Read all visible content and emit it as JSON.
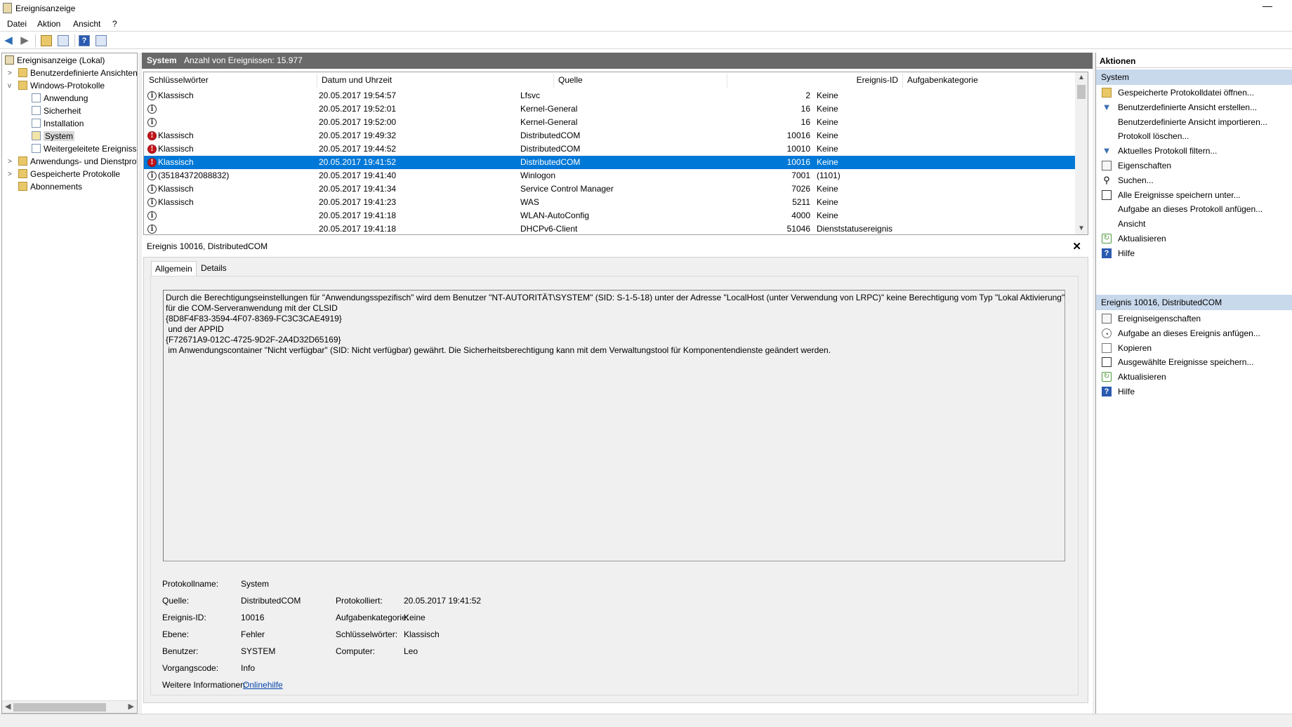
{
  "window": {
    "title": "Ereignisanzeige",
    "minimize": "—"
  },
  "menu": [
    "Datei",
    "Aktion",
    "Ansicht",
    "?"
  ],
  "tree": {
    "items": [
      {
        "label": "Ereignisanzeige (Lokal)",
        "icon": "event-viewer-icon"
      },
      {
        "label": "Benutzerdefinierte Ansichten",
        "icon": "folder-icon",
        "expander": ">"
      },
      {
        "label": "Windows-Protokolle",
        "icon": "folder-icon",
        "expander": "v"
      },
      {
        "label": "Anwendung",
        "icon": "log-icon"
      },
      {
        "label": "Sicherheit",
        "icon": "log-icon"
      },
      {
        "label": "Installation",
        "icon": "log-icon"
      },
      {
        "label": "System",
        "icon": "log-icon",
        "selected": true
      },
      {
        "label": "Weitergeleitete Ereignisse",
        "icon": "log-icon"
      },
      {
        "label": "Anwendungs- und Dienstprotokolle",
        "icon": "folder-icon",
        "expander": ">"
      },
      {
        "label": "Gespeicherte Protokolle",
        "icon": "folder-icon",
        "expander": ">"
      },
      {
        "label": "Abonnements",
        "icon": "subscriptions-icon"
      }
    ]
  },
  "center": {
    "title": "System",
    "count": "Anzahl von Ereignissen: 15.977",
    "columns": [
      "Schlüsselwörter",
      "Datum und Uhrzeit",
      "Quelle",
      "Ereignis-ID",
      "Aufgabenkategorie"
    ],
    "rows": [
      {
        "level": "info",
        "keyword": "Klassisch",
        "date": "20.05.2017 19:54:57",
        "source": "Lfsvc",
        "id": "2",
        "task": "Keine"
      },
      {
        "level": "info",
        "keyword": "",
        "date": "20.05.2017 19:52:01",
        "source": "Kernel-General",
        "id": "16",
        "task": "Keine"
      },
      {
        "level": "info",
        "keyword": "",
        "date": "20.05.2017 19:52:00",
        "source": "Kernel-General",
        "id": "16",
        "task": "Keine"
      },
      {
        "level": "error",
        "keyword": "Klassisch",
        "date": "20.05.2017 19:49:32",
        "source": "DistributedCOM",
        "id": "10016",
        "task": "Keine"
      },
      {
        "level": "error",
        "keyword": "Klassisch",
        "date": "20.05.2017 19:44:52",
        "source": "DistributedCOM",
        "id": "10010",
        "task": "Keine"
      },
      {
        "level": "error",
        "keyword": "Klassisch",
        "date": "20.05.2017 19:41:52",
        "source": "DistributedCOM",
        "id": "10016",
        "task": "Keine",
        "selected": true
      },
      {
        "level": "info",
        "keyword": "(35184372088832)",
        "date": "20.05.2017 19:41:40",
        "source": "Winlogon",
        "id": "7001",
        "task": "(1101)"
      },
      {
        "level": "info",
        "keyword": "Klassisch",
        "date": "20.05.2017 19:41:34",
        "source": "Service Control Manager",
        "id": "7026",
        "task": "Keine"
      },
      {
        "level": "info",
        "keyword": "Klassisch",
        "date": "20.05.2017 19:41:23",
        "source": "WAS",
        "id": "5211",
        "task": "Keine"
      },
      {
        "level": "info",
        "keyword": "",
        "date": "20.05.2017 19:41:18",
        "source": "WLAN-AutoConfig",
        "id": "4000",
        "task": "Keine"
      },
      {
        "level": "info",
        "keyword": "",
        "date": "20.05.2017 19:41:18",
        "source": "DHCPv6-Client",
        "id": "51046",
        "task": "Dienststatusereignis"
      }
    ]
  },
  "detail": {
    "title": "Ereignis 10016, DistributedCOM",
    "close": "✕",
    "tabs": [
      "Allgemein",
      "Details"
    ],
    "description": "Durch die Berechtigungseinstellungen für \"Anwendungsspezifisch\" wird dem Benutzer \"NT-AUTORITÄT\\SYSTEM\" (SID: S-1-5-18) unter der Adresse \"LocalHost (unter Verwendung von LRPC)\" keine Berechtigung vom Typ \"Lokal Aktivierung\"\nfür die COM-Serveranwendung mit der CLSID\n{8D8F4F83-3594-4F07-8369-FC3C3CAE4919}\n und der APPID\n{F72671A9-012C-4725-9D2F-2A4D32D65169}\n im Anwendungscontainer \"Nicht verfügbar\" (SID: Nicht verfügbar) gewährt. Die Sicherheitsberechtigung kann mit dem Verwaltungstool für Komponentendienste geändert werden.",
    "fields": {
      "protokollname_label": "Protokollname:",
      "protokollname": "System",
      "quelle_label": "Quelle:",
      "quelle": "DistributedCOM",
      "protokolliert_label": "Protokolliert:",
      "protokolliert": "20.05.2017 19:41:52",
      "ereignis_id_label": "Ereignis-ID:",
      "ereignis_id": "10016",
      "aufgabenkategorie_label": "Aufgabenkategorie:",
      "aufgabenkategorie": "Keine",
      "ebene_label": "Ebene:",
      "ebene": "Fehler",
      "schluesselwoerter_label": "Schlüsselwörter:",
      "schluesselwoerter": "Klassisch",
      "benutzer_label": "Benutzer:",
      "benutzer": "SYSTEM",
      "computer_label": "Computer:",
      "computer": "Leo",
      "vorgangscode_label": "Vorgangscode:",
      "vorgangscode": "Info",
      "weitere_label": "Weitere Informationen:",
      "weitere_link": "Onlinehilfe"
    }
  },
  "actions": {
    "header": "Aktionen",
    "group1": "System",
    "group1_items": [
      {
        "label": "Gespeicherte Protokolldatei öffnen...",
        "icon": "open-folder-icon"
      },
      {
        "label": "Benutzerdefinierte Ansicht erstellen...",
        "icon": "create-view-icon"
      },
      {
        "label": "Benutzerdefinierte Ansicht importieren...",
        "icon": ""
      },
      {
        "label": "Protokoll löschen...",
        "icon": ""
      },
      {
        "label": "Aktuelles Protokoll filtern...",
        "icon": "filter-icon"
      },
      {
        "label": "Eigenschaften",
        "icon": "properties-icon"
      },
      {
        "label": "Suchen...",
        "icon": "binoculars-icon"
      },
      {
        "label": "Alle Ereignisse speichern unter...",
        "icon": "save-icon"
      },
      {
        "label": "Aufgabe an dieses Protokoll anfügen...",
        "icon": ""
      },
      {
        "label": "Ansicht",
        "icon": ""
      },
      {
        "label": "Aktualisieren",
        "icon": "refresh-icon"
      },
      {
        "label": "Hilfe",
        "icon": "help-icon"
      }
    ],
    "group2": "Ereignis 10016, DistributedCOM",
    "group2_items": [
      {
        "label": "Ereigniseigenschaften",
        "icon": "properties-icon"
      },
      {
        "label": "Aufgabe an dieses Ereignis anfügen...",
        "icon": "task-icon"
      },
      {
        "label": "Kopieren",
        "icon": "copy-icon"
      },
      {
        "label": "Ausgewählte Ereignisse speichern...",
        "icon": "save-icon"
      },
      {
        "label": "Aktualisieren",
        "icon": "refresh-icon"
      },
      {
        "label": "Hilfe",
        "icon": "help-icon"
      }
    ]
  }
}
